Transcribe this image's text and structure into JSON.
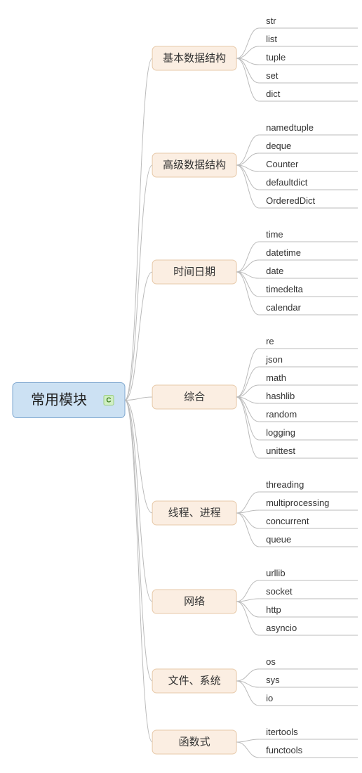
{
  "root": {
    "label": "常用模块",
    "badge": "C"
  },
  "branches": [
    {
      "label": "基本数据结构",
      "leaves": [
        "str",
        "list",
        "tuple",
        "set",
        "dict"
      ]
    },
    {
      "label": "高级数据结构",
      "leaves": [
        "namedtuple",
        "deque",
        "Counter",
        "defaultdict",
        "OrderedDict"
      ]
    },
    {
      "label": "时间日期",
      "leaves": [
        "time",
        "datetime",
        "date",
        "timedelta",
        "calendar"
      ]
    },
    {
      "label": "综合",
      "leaves": [
        "re",
        "json",
        "math",
        "hashlib",
        "random",
        "logging",
        "unittest"
      ]
    },
    {
      "label": "线程、进程",
      "leaves": [
        "threading",
        "multiprocessing",
        "concurrent",
        "queue"
      ]
    },
    {
      "label": "网络",
      "leaves": [
        "urllib",
        "socket",
        "http",
        "asyncio"
      ]
    },
    {
      "label": "文件、系统",
      "leaves": [
        "os",
        "sys",
        "io"
      ]
    },
    {
      "label": "函数式",
      "leaves": [
        "itertools",
        "functools"
      ]
    }
  ]
}
